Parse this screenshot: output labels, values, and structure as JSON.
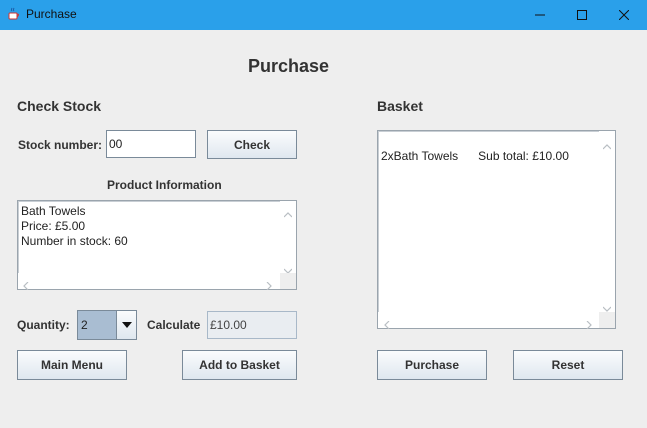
{
  "window": {
    "title": "Purchase",
    "icon": "java-cup-icon",
    "controls": [
      "minimize-icon",
      "maximize-icon",
      "close-icon"
    ],
    "titlebar_color": "#2aa0ea"
  },
  "page": {
    "title": "Purchase"
  },
  "check_stock": {
    "heading": "Check Stock",
    "stock_number_label": "Stock number:",
    "stock_number_value": "00",
    "check_button": "Check",
    "product_info_heading": "Product Information",
    "product_info_text": "Bath Towels\nPrice: £5.00\nNumber in stock: 60"
  },
  "basket": {
    "heading": "Basket",
    "content": "2xBath Towels      Sub total: £10.00"
  },
  "order": {
    "quantity_label": "Quantity:",
    "quantity_value": "2",
    "calculate_label": "Calculate",
    "calculate_value": "£10.00"
  },
  "buttons": {
    "main_menu": "Main Menu",
    "add_to_basket": "Add to Basket",
    "purchase": "Purchase",
    "reset": "Reset"
  }
}
